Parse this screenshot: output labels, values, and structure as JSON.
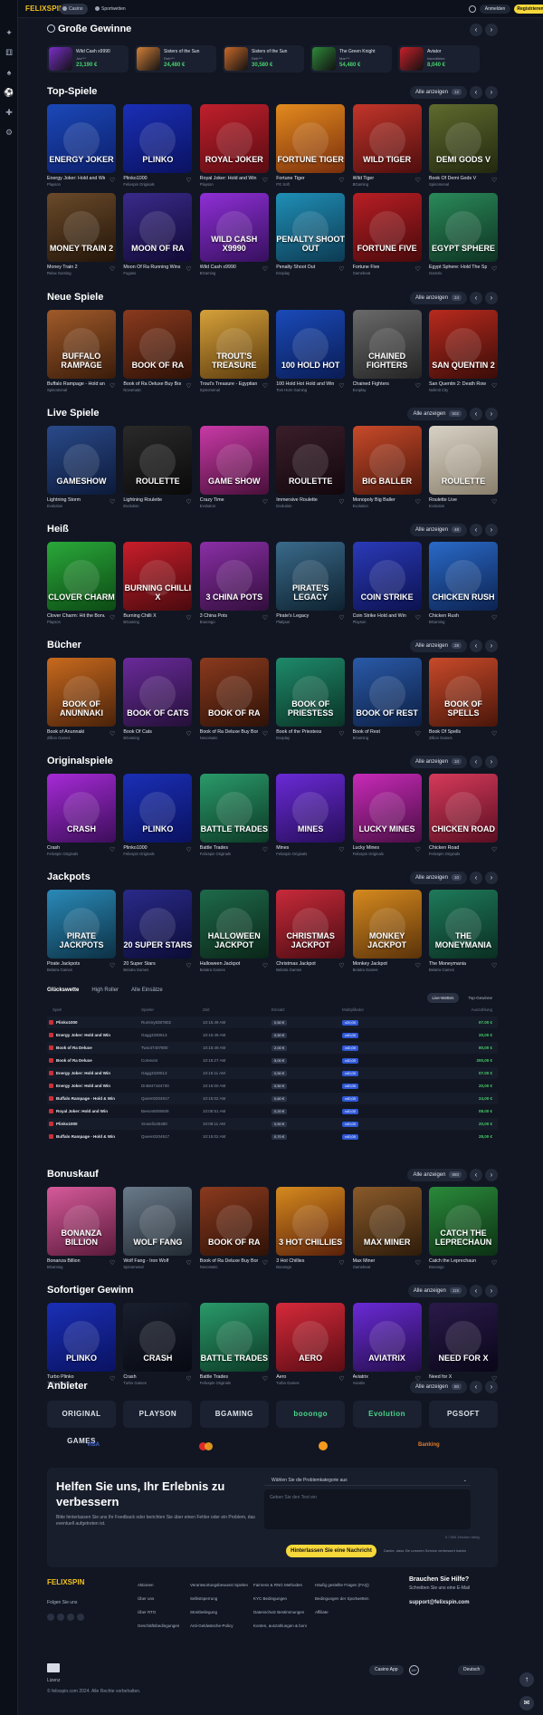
{
  "header": {
    "logo": "FELIXSPIN",
    "tabs": [
      {
        "label": "Casino"
      },
      {
        "label": "Sportwetten"
      }
    ],
    "login": "Anmelden",
    "register": "Registrieren"
  },
  "sidebar_icons": [
    "gift-icon",
    "dice-icon",
    "cards-icon",
    "soccer-icon",
    "joystick-icon",
    "settings-icon"
  ],
  "big_wins": {
    "title": "Große Gewinne",
    "items": [
      {
        "game": "Wild Cash x9990",
        "user": "Jes***",
        "amount": "23,190 €",
        "color": "#7a2fc9"
      },
      {
        "game": "Sisters of the Sun",
        "user": "Reb***",
        "amount": "24,480 €",
        "color": "#d4813a"
      },
      {
        "game": "Sisters of the Sun",
        "user": "Reb***",
        "amount": "30,580 €",
        "color": "#c96a2a"
      },
      {
        "game": "The Green Knight",
        "user": "Mar***",
        "amount": "54,480 €",
        "color": "#2f8a3a"
      },
      {
        "game": "Aviator",
        "user": "Inkrediblee",
        "amount": "8,040 €",
        "color": "#c8202a"
      }
    ]
  },
  "sections": [
    {
      "title": "Top-Spiele",
      "all": "Alle anzeigen",
      "count": "12",
      "rows": [
        [
          {
            "n": "Energy Joker: Hold and Win",
            "p": "Playson",
            "t": "ENERGY JOKER",
            "c1": "#1b48b8",
            "c2": "#0c1f6b"
          },
          {
            "n": "Plinko1000",
            "p": "Felixspin Originals",
            "t": "PLINKO",
            "c1": "#1a2fb6",
            "c2": "#0a1260"
          },
          {
            "n": "Royal Joker: Hold and Win",
            "p": "Playson",
            "t": "ROYAL JOKER",
            "c1": "#c0202c",
            "c2": "#5a0b12"
          },
          {
            "n": "Fortune Tiger",
            "p": "PG Soft",
            "t": "FORTUNE TIGER",
            "c1": "#e38a1e",
            "c2": "#7a2f0c"
          },
          {
            "n": "Wild Tiger",
            "p": "BGaming",
            "t": "WILD TIGER",
            "c1": "#c2352a",
            "c2": "#4f0e0e"
          },
          {
            "n": "Book Of Demi Gods V",
            "p": "Spinomenal",
            "t": "DEMI GODS V",
            "c1": "#5e6b2e",
            "c2": "#23280f"
          }
        ],
        [
          {
            "n": "Money Train 2",
            "p": "Relax Gaming",
            "t": "MONEY TRAIN 2",
            "c1": "#6a4a2a",
            "c2": "#241509"
          },
          {
            "n": "Moon Of Ra Running Wins",
            "p": "Fugaso",
            "t": "MOON OF RA",
            "c1": "#3a2a8a",
            "c2": "#120a36"
          },
          {
            "n": "Wild Cash x9990",
            "p": "BGaming",
            "t": "WILD CASH X9990",
            "c1": "#8f2fd6",
            "c2": "#36105e"
          },
          {
            "n": "Penalty Shoot Out",
            "p": "Evoplay",
            "t": "PENALTY SHOOT OUT",
            "c1": "#1f8fb6",
            "c2": "#0d3a52"
          },
          {
            "n": "Fortune Five",
            "p": "Gamebeat",
            "t": "FORTUNE FIVE",
            "c1": "#b81e24",
            "c2": "#4a0a0c"
          },
          {
            "n": "Egypt Sphere: Hold The Spin",
            "p": "Gamzix",
            "t": "EGYPT SPHERE",
            "c1": "#2a8a5a",
            "c2": "#0e3322"
          }
        ]
      ]
    },
    {
      "title": "Neue Spiele",
      "all": "Alle anzeigen",
      "count": "24",
      "rows": [
        [
          {
            "n": "Buffalo Rampage - Hold and Win",
            "p": "Spinomenal",
            "t": "BUFFALO RAMPAGE",
            "c1": "#a05a2a",
            "c2": "#3a1c0a"
          },
          {
            "n": "Book of Ra Deluxe Buy Bonus",
            "p": "Novomatic",
            "t": "BOOK OF RA",
            "c1": "#8a3a1e",
            "c2": "#2f1207"
          },
          {
            "n": "Trout's Treasure - Egyptian Levels",
            "p": "Spinomenal",
            "t": "TROUT'S TREASURE",
            "c1": "#d6a13a",
            "c2": "#5a3a0e"
          },
          {
            "n": "100 Hold Hot Hold and Win",
            "p": "Tom Horn Gaming",
            "t": "100 HOLD HOT",
            "c1": "#1a4ab8",
            "c2": "#0a1c55"
          },
          {
            "n": "Chained Fighters",
            "p": "Evoplay",
            "t": "CHAINED FIGHTERS",
            "c1": "#6a6a6a",
            "c2": "#242424"
          },
          {
            "n": "San Quentin 2: Death Row",
            "p": "Nolimit City",
            "t": "SAN QUENTIN 2",
            "c1": "#b82a1e",
            "c2": "#3a0c08"
          }
        ]
      ]
    },
    {
      "title": "Live Spiele",
      "all": "Alle anzeigen",
      "count": "502",
      "rows": [
        [
          {
            "n": "Lightning Storm",
            "p": "Evolution",
            "t": "GAMESHOW",
            "c1": "#2a4a8a",
            "c2": "#0c1a3a"
          },
          {
            "n": "Lightning Roulette",
            "p": "Evolution",
            "t": "ROULETTE",
            "c1": "#2a2a2a",
            "c2": "#0a0a0a"
          },
          {
            "n": "Crazy Time",
            "p": "Evolution",
            "t": "GAME SHOW",
            "c1": "#c83aa6",
            "c2": "#4a0f3a"
          },
          {
            "n": "Immersive Roulette",
            "p": "Evolution",
            "t": "ROULETTE",
            "c1": "#3a1e2a",
            "c2": "#12070c"
          },
          {
            "n": "Monopoly Big Baller",
            "p": "Evolution",
            "t": "BIG BALLER",
            "c1": "#c84a2a",
            "c2": "#4a160a"
          },
          {
            "n": "Roulette Live",
            "p": "Evolution",
            "t": "ROULETTE",
            "c1": "#d8d2c6",
            "c2": "#8a7f6c"
          }
        ]
      ]
    },
    {
      "title": "Heiß",
      "all": "Alle anzeigen",
      "count": "48",
      "rows": [
        [
          {
            "n": "Clover Charm: Hit the Bonus",
            "p": "Playson",
            "t": "CLOVER CHARM",
            "c1": "#2aa83a",
            "c2": "#0c4a14"
          },
          {
            "n": "Burning Chilli X",
            "p": "BGaming",
            "t": "BURNING CHILLI X",
            "c1": "#c81e2a",
            "c2": "#4a0a0e"
          },
          {
            "n": "3 China Pots",
            "p": "Booongo",
            "t": "3 CHINA POTS",
            "c1": "#8a2fa6",
            "c2": "#320e3c"
          },
          {
            "n": "Pirate's Legacy",
            "p": "Platipus",
            "t": "PIRATE'S LEGACY",
            "c1": "#3a6a8a",
            "c2": "#0e2230"
          },
          {
            "n": "Coin Strike Hold and Win",
            "p": "Playson",
            "t": "COIN STRIKE",
            "c1": "#2a3ab8",
            "c2": "#0c1250"
          },
          {
            "n": "Chicken Rush",
            "p": "BGaming",
            "t": "CHICKEN RUSH",
            "c1": "#2a6ac8",
            "c2": "#0c2250"
          }
        ]
      ]
    },
    {
      "title": "Bücher",
      "all": "Alle anzeigen",
      "count": "28",
      "rows": [
        [
          {
            "n": "Book of Anunnaki",
            "p": "Zillion Games",
            "t": "BOOK OF ANUNNAKI",
            "c1": "#c86a1e",
            "c2": "#4a220a"
          },
          {
            "n": "Book Of Cats",
            "p": "BGaming",
            "t": "BOOK OF CATS",
            "c1": "#6a2a9a",
            "c2": "#241038"
          },
          {
            "n": "Book of Ra Deluxe Buy Bonus",
            "p": "Novomatic",
            "t": "BOOK OF RA",
            "c1": "#8a3a1e",
            "c2": "#2f1207"
          },
          {
            "n": "Book of the Priestess",
            "p": "Evoplay",
            "t": "BOOK OF PRIESTESS",
            "c1": "#1e8a6a",
            "c2": "#0a3326"
          },
          {
            "n": "Book of Rest",
            "p": "BGaming",
            "t": "BOOK OF REST",
            "c1": "#2a5aa8",
            "c2": "#0c1f44"
          },
          {
            "n": "Book Of Spells",
            "p": "Zillion Games",
            "t": "BOOK OF SPELLS",
            "c1": "#c84a2a",
            "c2": "#4a160a"
          }
        ]
      ]
    },
    {
      "title": "Originalspiele",
      "all": "Alle anzeigen",
      "count": "10",
      "rows": [
        [
          {
            "n": "Crash",
            "p": "Felixspin Originals",
            "t": "CRASH",
            "c1": "#a62ad6",
            "c2": "#3c0e5a"
          },
          {
            "n": "Plinko1000",
            "p": "Felixspin Originals",
            "t": "PLINKO",
            "c1": "#1a2fb6",
            "c2": "#0a1260"
          },
          {
            "n": "Battle Trades",
            "p": "Felixspin Originals",
            "t": "BATTLE TRADES",
            "c1": "#2a9a6a",
            "c2": "#0c3a26"
          },
          {
            "n": "Mines",
            "p": "Felixspin Originals",
            "t": "MINES",
            "c1": "#6a2ad6",
            "c2": "#260e5a"
          },
          {
            "n": "Lucky Mines",
            "p": "Felixspin Originals",
            "t": "LUCKY MINES",
            "c1": "#c82ab8",
            "c2": "#4a0e44"
          },
          {
            "n": "Chicken Road",
            "p": "Felixspin Originals",
            "t": "CHICKEN ROAD",
            "c1": "#d63a5a",
            "c2": "#5a0e22"
          }
        ]
      ]
    },
    {
      "title": "Jackpots",
      "all": "Alle anzeigen",
      "count": "10",
      "rows": [
        [
          {
            "n": "Pirate Jackpots",
            "p": "Belatra Games",
            "t": "PIRATE JACKPOTS",
            "c1": "#2a8ab8",
            "c2": "#0c3044"
          },
          {
            "n": "20 Super Stars",
            "p": "Belatra Games",
            "t": "20 SUPER STARS",
            "c1": "#2a2a8a",
            "c2": "#0c0c36"
          },
          {
            "n": "Halloween Jackpot",
            "p": "Belatra Games",
            "t": "HALLOWEEN JACKPOT",
            "c1": "#1e6a4a",
            "c2": "#0a2618"
          },
          {
            "n": "Christmas Jackpot",
            "p": "Belatra Games",
            "t": "CHRISTMAS JACKPOT",
            "c1": "#c82a3a",
            "c2": "#4a0c12"
          },
          {
            "n": "Monkey Jackpot",
            "p": "Belatra Games",
            "t": "MONKEY JACKPOT",
            "c1": "#d68a1e",
            "c2": "#5a320a"
          },
          {
            "n": "The Moneymania",
            "p": "Belatra Games",
            "t": "THE MONEYMANIA",
            "c1": "#1e7a5a",
            "c2": "#0a2e22"
          }
        ]
      ]
    },
    {
      "title": "Bonuskauf",
      "all": "Alle anzeigen",
      "count": "880",
      "rows": [
        [
          {
            "n": "Bonanza Billion",
            "p": "BGaming",
            "t": "BONANZA BILLION",
            "c1": "#d65a9a",
            "c2": "#5a1a3a"
          },
          {
            "n": "Wolf Fang - Iron Wolf",
            "p": "Spinomenal",
            "t": "WOLF FANG",
            "c1": "#6a7a8a",
            "c2": "#222a32"
          },
          {
            "n": "Book of Ra Deluxe Buy Bonus",
            "p": "Novomatic",
            "t": "BOOK OF RA",
            "c1": "#8a3a1e",
            "c2": "#2f1207"
          },
          {
            "n": "3 Hot Chillies",
            "p": "Booongo",
            "t": "3 HOT CHILLIES",
            "c1": "#d68a1e",
            "c2": "#5a200a"
          },
          {
            "n": "Max Miner",
            "p": "Gamebeat",
            "t": "MAX MINER",
            "c1": "#8a5a2a",
            "c2": "#2e1c0a"
          },
          {
            "n": "Catch the Leprechaun",
            "p": "Booongo",
            "t": "CATCH THE LEPRECHAUN",
            "c1": "#2a8a3a",
            "c2": "#0c3014"
          }
        ]
      ]
    },
    {
      "title": "Sofortiger Gewinn",
      "all": "Alle anzeigen",
      "count": "115",
      "rows": [
        [
          {
            "n": "Turbo Plinko",
            "p": "Turbo Games",
            "t": "PLINKO",
            "c1": "#1a2fb6",
            "c2": "#0a1260"
          },
          {
            "n": "Crash",
            "p": "Turbo Games",
            "t": "CRASH",
            "c1": "#1a1f2e",
            "c2": "#070a12"
          },
          {
            "n": "Battle Trades",
            "p": "Felixspin Originals",
            "t": "BATTLE TRADES",
            "c1": "#2a9a6a",
            "c2": "#0c3a26"
          },
          {
            "n": "Aero",
            "p": "Turbo Games",
            "t": "AERO",
            "c1": "#d62a3a",
            "c2": "#5a0c14"
          },
          {
            "n": "Aviatrix",
            "p": "Aviatrix",
            "t": "AVIATRIX",
            "c1": "#6a2ad6",
            "c2": "#240e4a"
          },
          {
            "n": "Need for X",
            "p": "Turbo Games",
            "t": "NEED FOR X",
            "c1": "#2a1a4a",
            "c2": "#0a0618"
          }
        ]
      ]
    }
  ],
  "bets": {
    "tabs": [
      "Glückswette",
      "High Roller",
      "Alle Einsätze"
    ],
    "buttons": [
      "Live-Wetten",
      "Top-Gewinne"
    ],
    "headers": [
      "Spiel",
      "Spieler",
      "Zeit",
      "Einsatz",
      "Multiplikator",
      "Auszahlung"
    ],
    "rows": [
      [
        "Plinko1000",
        "Rummy8387802",
        "10:15:49 AM",
        "0,50 €",
        "x20,00",
        "07.00 €"
      ],
      [
        "Energy Joker: Hold and Win",
        "Gagg3330513",
        "10:15:49 AM",
        "0,50 €",
        "x40,00",
        "20,00 €"
      ],
      [
        "Book of Ra Deluxe",
        "Twoot7407800",
        "10:15:49 AM",
        "2,00 €",
        "x40,00",
        "80,00 €"
      ],
      [
        "Book of Ra Deluxe",
        "Comeonr",
        "10:15:27 AM",
        "5,00 €",
        "x40,00",
        "200,00 €"
      ],
      [
        "Energy Joker: Hold and Win",
        "Gagg3330513",
        "10:15:11 AM",
        "0,50 €",
        "x40,00",
        "07.00 €"
      ],
      [
        "Energy Joker: Hold and Win",
        "Dn6847184730",
        "10:15:00 AM",
        "0,50 €",
        "x40,00",
        "20,00 €"
      ],
      [
        "Buffalo Rampage - Hold & Win",
        "Queen0204917",
        "10:15:02 AM",
        "0,60 €",
        "x40,00",
        "24,00 €"
      ],
      [
        "Royal Joker: Hold and Win",
        "Beeon5006509",
        "10:05:51 AM",
        "0,20 €",
        "x40,00",
        "08.00 €"
      ],
      [
        "Plinko1000",
        "Xroseli145480",
        "10:08:11 AM",
        "0,50 €",
        "x40,00",
        "20,00 €"
      ],
      [
        "Buffalo Rampage - Hold & Win",
        "Queen0204917",
        "10:15:02 AM",
        "0,70 €",
        "x40,00",
        "28,00 €"
      ]
    ]
  },
  "providers": {
    "title": "Anbieter",
    "all": "Alle anzeigen",
    "count": "80",
    "items": [
      "ORIGINAL GAMES",
      "PLAYSON",
      "BGAMING",
      "booongo",
      "Evolution",
      "PGSOFT"
    ]
  },
  "payments": [
    "VISA",
    "",
    "",
    "Banking"
  ],
  "feedback": {
    "title": "Helfen Sie uns, Ihr Erlebnis zu verbessern",
    "text": "Bitte hinterlassen Sie uns Ihr Feedback oder berichten Sie über einen Fehler oder ein Problem, das eventuell aufgetreten ist.",
    "select": "Wählen Sie die Problemkategorie aus",
    "placeholder": "Geben Sie den Text ein",
    "count": "0 / 500 Zeichen übrig",
    "send": "Hinterlassen Sie eine Nachricht",
    "note": "Danke, dass Sie unseren Service verbessert haben"
  },
  "footer": {
    "logo": "FELIXSPIN",
    "follow": "Folgen Sie uns",
    "cols": [
      [
        "Aktionen",
        "Über uns",
        "Über RTG",
        "Geschäftsbedingungen"
      ],
      [
        "Verantwortungsbewusst Spielen",
        "Selbstsperrung",
        "Streitbeilegung",
        "Anti-Geldwäsche-Policy"
      ],
      [
        "Fairness & RNG Methoden",
        "KYC Bedingungen",
        "Datenschutz Bestimmungen",
        "Konten, auszahlungen & boni"
      ],
      [
        "Häufig gestellte Fragen (FAQ)",
        "Bedingungen der Sportwetten",
        "Affiliate"
      ]
    ],
    "help_title": "Brauchen Sie Hilfe?",
    "help_text": "Schreiben Sie uns eine E-Mail",
    "email": "support@felixspin.com",
    "lizenz": "Lizenz",
    "copy": "© felixspin.com 2024. Alle Rechte vorbehalten.",
    "app": "Casino App",
    "lang": "Deutsch"
  }
}
